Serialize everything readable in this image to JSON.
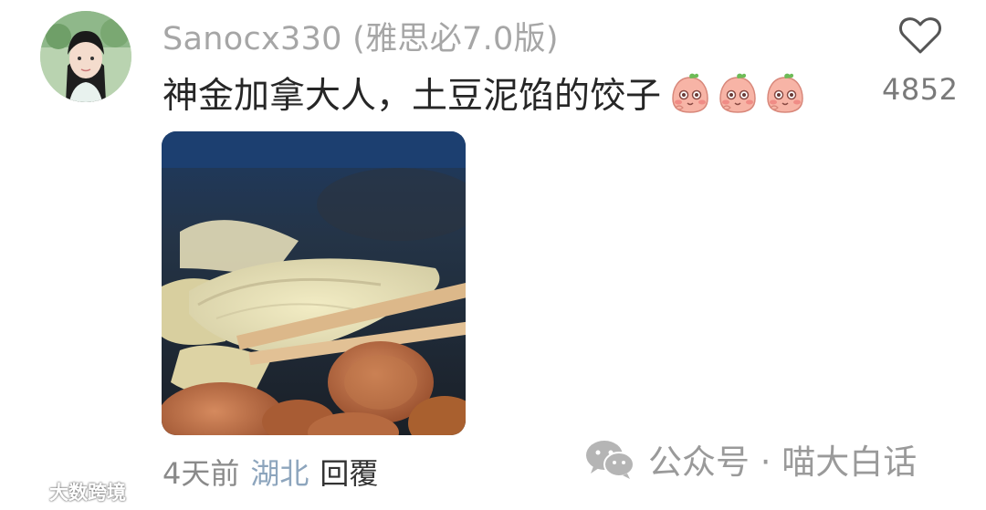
{
  "comment": {
    "username": "Sanocx330 (雅思必7.0版)",
    "text": "神金加拿大人，土豆泥馅的饺子",
    "emoji_count": 3,
    "emoji_icon": "blush-face-emoji-icon",
    "likes": "4852",
    "time": "4天前",
    "location": "湖北",
    "reply_label": "回覆"
  },
  "watermarks": {
    "wechat_account": "公众号 · 喵大白话",
    "brand": "大数跨境"
  },
  "colors": {
    "username": "#a6a6a6",
    "location": "#8da5bd",
    "text": "#262626"
  }
}
